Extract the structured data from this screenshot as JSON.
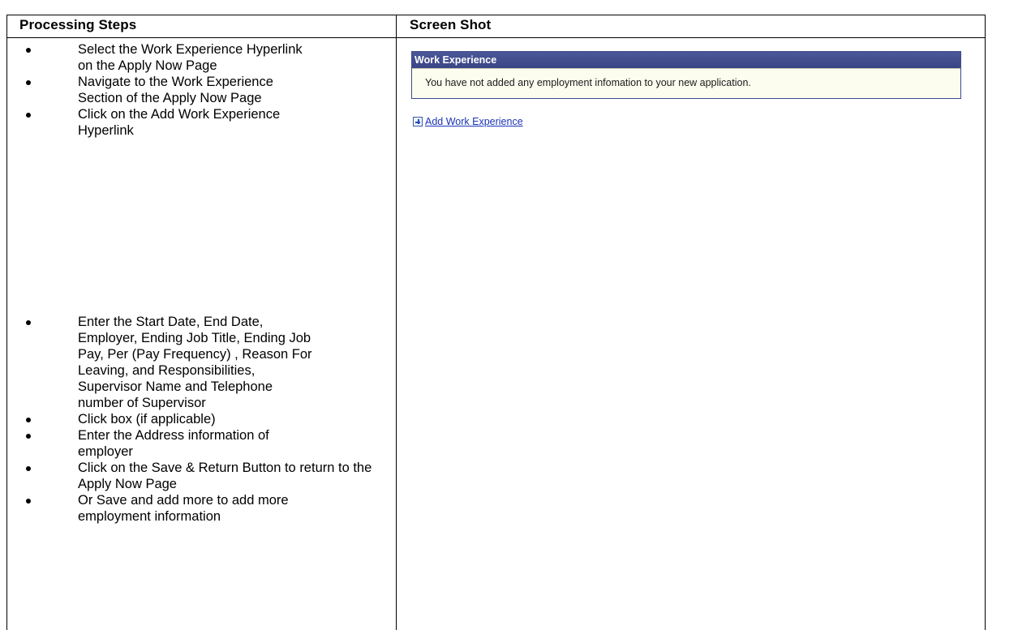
{
  "table": {
    "left_header": "Processing Steps",
    "right_header": "Screen Shot"
  },
  "steps_group1": [
    "Select the Work Experience Hyperlink on the Apply Now Page",
    "Navigate to the Work Experience Section of the Apply Now Page",
    "Click on the Add Work Experience Hyperlink"
  ],
  "steps_group2": [
    "Enter the Start Date, End Date, Employer, Ending Job Title, Ending Job Pay, Per (Pay Frequency) , Reason For Leaving, and Responsibilities, Supervisor Name and Telephone number of Supervisor",
    "Click box (if applicable)",
    "Enter the Address information of employer",
    "Click on the Save & Return Button to return to the Apply Now Page",
    "Or Save and add more  to add more employment information"
  ],
  "screenshot": {
    "panel_title": "Work Experience",
    "panel_message": "You have not added any employment infomation to your new application.",
    "add_link_label": "Add Work Experience",
    "add_link_icon": "plus-icon",
    "colors": {
      "panel_header": "#3e4a8a",
      "panel_body": "#fcfcef",
      "link": "#1a34b8"
    }
  }
}
